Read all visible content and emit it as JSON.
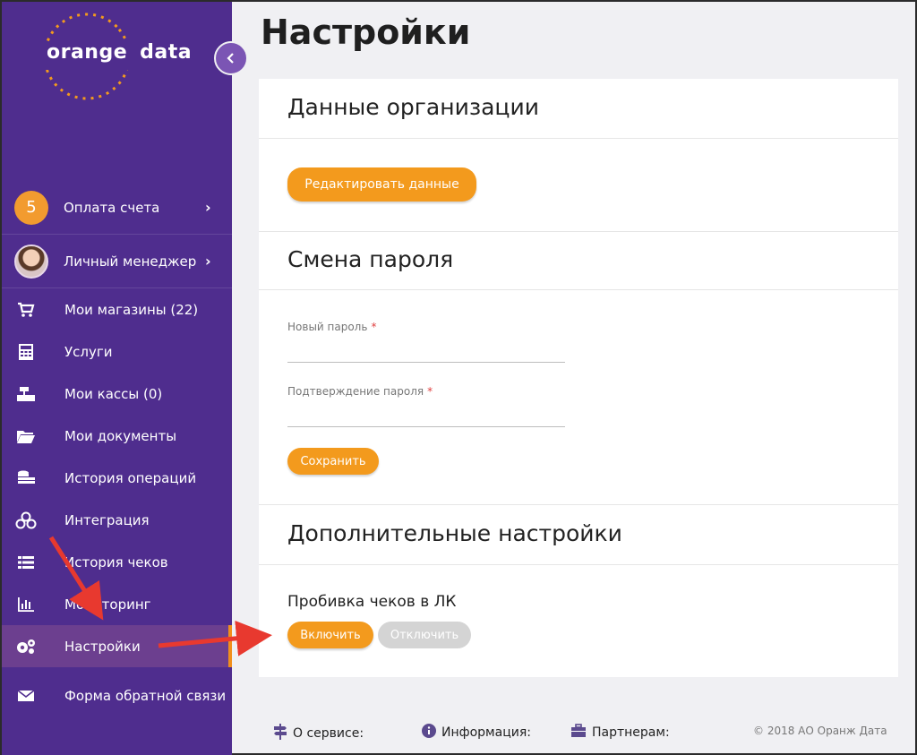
{
  "brand": {
    "name_left": "orange",
    "name_right": "data",
    "color": "#f39a1d"
  },
  "sidebar": {
    "collapse_icon": "chevron-left-icon",
    "items": [
      {
        "label": "Оплата счета",
        "badge": "5",
        "chevron": "›"
      },
      {
        "label": "Личный менеджер",
        "chevron": "›"
      },
      {
        "label": "Мои магазины (22)",
        "icon": "cart-icon"
      },
      {
        "label": "Услуги",
        "icon": "calculator-icon"
      },
      {
        "label": "Мои кассы (0)",
        "icon": "cash-register-icon"
      },
      {
        "label": "Мои документы",
        "icon": "folder-icon"
      },
      {
        "label": "История операций",
        "icon": "coins-icon"
      },
      {
        "label": "Интеграция",
        "icon": "cubes-icon"
      },
      {
        "label": "История чеков",
        "icon": "list-icon"
      },
      {
        "label": "Мониторинг",
        "icon": "bar-chart-icon"
      },
      {
        "label": "Настройки",
        "icon": "gears-icon",
        "active": true
      },
      {
        "label": "Форма обратной связи",
        "icon": "envelope-icon"
      }
    ]
  },
  "page": {
    "title": "Настройки"
  },
  "org": {
    "title": "Данные организации",
    "edit_button": "Редактировать данные"
  },
  "password": {
    "title": "Смена пароля",
    "new_label": "Новый пароль",
    "confirm_label": "Подтверждение пароля",
    "required_mark": "*",
    "save_button": "Сохранить"
  },
  "extra": {
    "title": "Дополнительные настройки",
    "subheading": "Пробивка чеков в ЛК",
    "enable_button": "Включить",
    "disable_button": "Отключить"
  },
  "footer": {
    "about": "О сервисе:",
    "info": "Информация:",
    "partners": "Партнерам:",
    "copyright": "© 2018 АО Оранж Дата"
  },
  "colors": {
    "sidebar": "#4f2d8e",
    "accent": "#f39a1d",
    "arrow": "#e8392f"
  }
}
